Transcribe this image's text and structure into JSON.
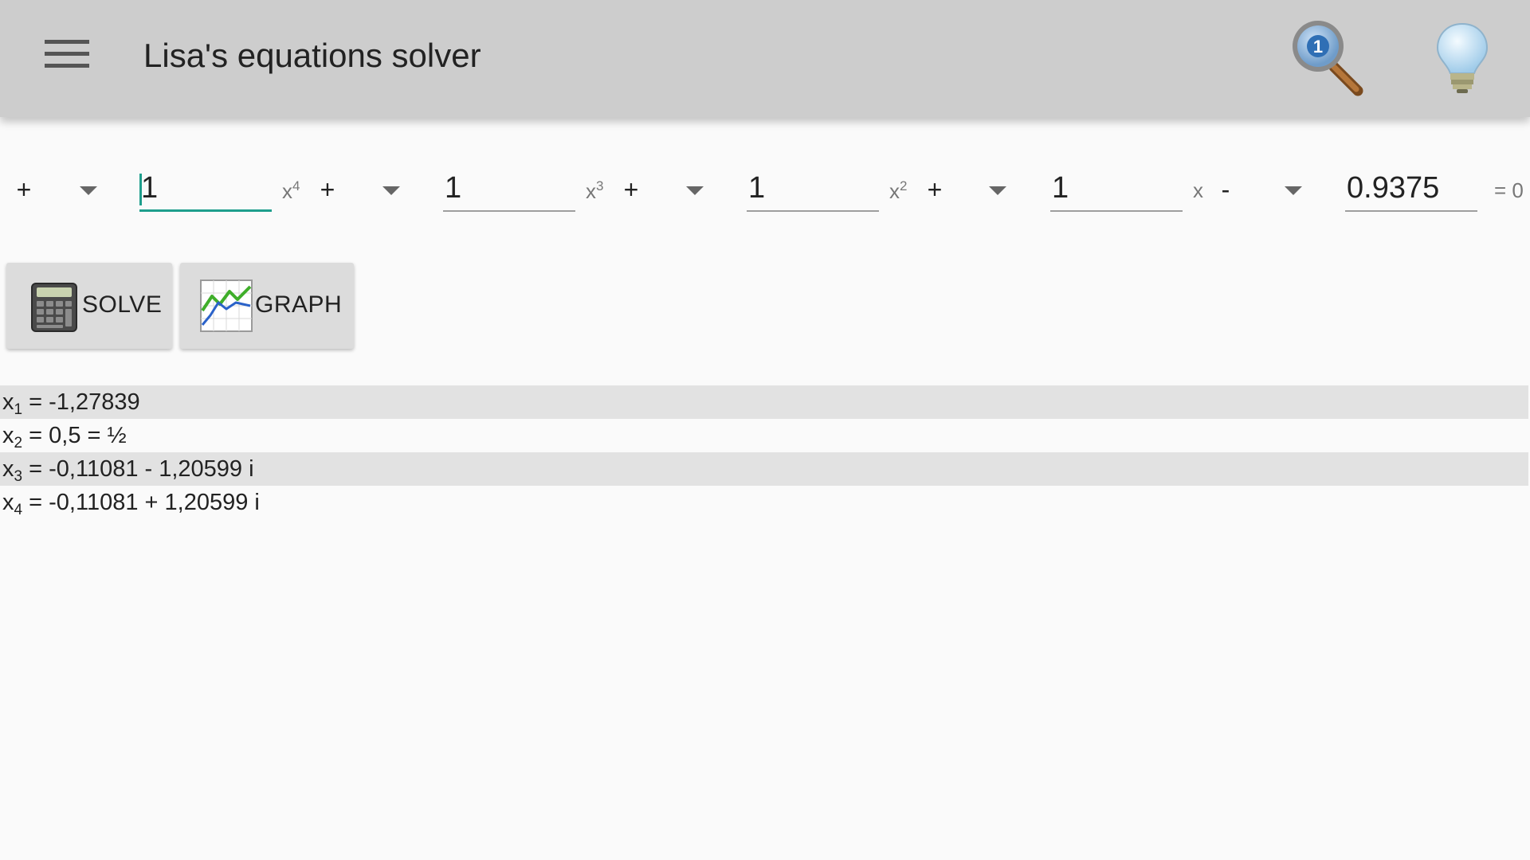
{
  "app": {
    "title": "Lisa's equations solver"
  },
  "toolbar": {
    "menu_icon": "hamburger-menu-icon",
    "search_icon": "magnifier-hint-1-icon",
    "tip_icon": "lightbulb-icon"
  },
  "equation": {
    "terms": [
      {
        "sign": "+",
        "coefficient": "1",
        "power_base": "x",
        "power_exp": "4"
      },
      {
        "sign": "+",
        "coefficient": "1",
        "power_base": "x",
        "power_exp": "3"
      },
      {
        "sign": "+",
        "coefficient": "1",
        "power_base": "x",
        "power_exp": "2"
      },
      {
        "sign": "+",
        "coefficient": "1",
        "power_base": "x",
        "power_exp": ""
      },
      {
        "sign": "-",
        "coefficient": "0.9375",
        "power_base": "",
        "power_exp": ""
      }
    ],
    "equals": "= 0"
  },
  "buttons": {
    "solve": "SOLVE",
    "graph": "GRAPH"
  },
  "results": [
    {
      "var": "x",
      "index": "1",
      "value": " = -1,27839"
    },
    {
      "var": "x",
      "index": "2",
      "value": " = 0,5 = ½"
    },
    {
      "var": "x",
      "index": "3",
      "value": " = -0,11081 - 1,20599 i"
    },
    {
      "var": "x",
      "index": "4",
      "value": " = -0,11081 + 1,20599 i"
    }
  ],
  "colors": {
    "appbar": "#cdcdcd",
    "accent": "#1e9e8c",
    "background": "#fafafa",
    "row_shade": "#e2e2e2"
  }
}
